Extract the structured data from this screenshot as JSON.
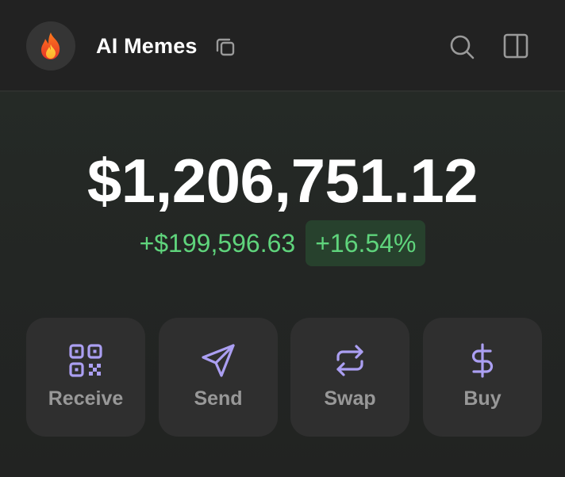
{
  "header": {
    "avatar_emoji": "🔥",
    "avatar_icon": "fire-icon",
    "wallet_name": "AI Memes",
    "copy_icon": "copy-icon",
    "search_icon": "search-icon",
    "sidebar_icon": "sidebar-panel-icon"
  },
  "balance": {
    "total": "$1,206,751.12",
    "change_amount": "+$199,596.63",
    "change_percent": "+16.54%"
  },
  "actions": [
    {
      "label": "Receive",
      "icon": "qr-code-icon"
    },
    {
      "label": "Send",
      "icon": "send-icon"
    },
    {
      "label": "Swap",
      "icon": "swap-icon"
    },
    {
      "label": "Buy",
      "icon": "dollar-icon"
    }
  ],
  "colors": {
    "background": "#222222",
    "positive_green": "#5fd47c",
    "positive_pill_bg": "#27412d",
    "action_icon_purple": "#ab9ff2",
    "action_label_gray": "#989898",
    "action_button_bg": "#2f2f2f"
  }
}
